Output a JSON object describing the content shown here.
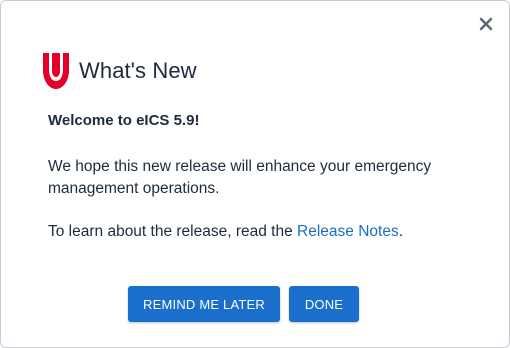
{
  "dialog": {
    "title": "What's New",
    "close_icon": "close-icon",
    "logo_icon": "juvare-logo-icon",
    "welcome": "Welcome to eICS 5.9!",
    "description": "We hope this new release will enhance your emergency management operations.",
    "learn_prefix": "To learn about the release, read the ",
    "learn_link": "Release Notes",
    "learn_suffix": ".",
    "buttons": {
      "remind_later": "REMIND ME LATER",
      "done": "DONE"
    }
  },
  "colors": {
    "accent": "#1a6fcd",
    "link": "#1c6ec4",
    "logo_red": "#e4002b",
    "text": "#1f2b3d",
    "close_icon": "#6b7585"
  }
}
